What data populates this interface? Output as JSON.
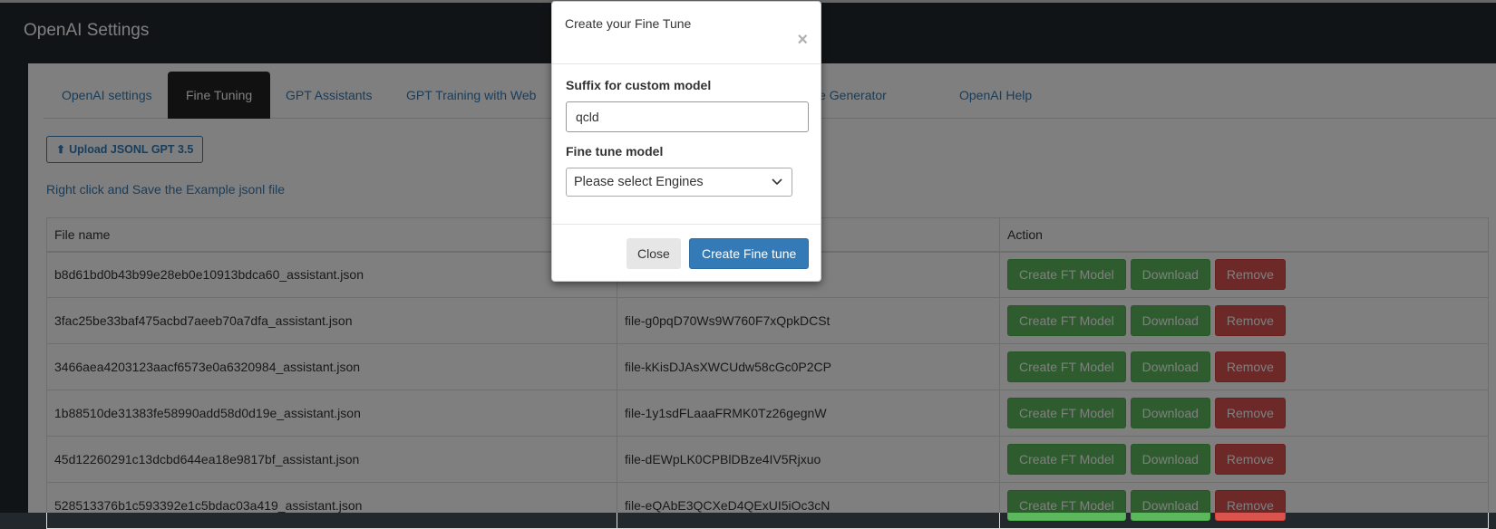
{
  "header": {
    "title": "OpenAI Settings"
  },
  "tabs": [
    {
      "label": "OpenAI settings",
      "active": false
    },
    {
      "label": "Fine Tuning",
      "active": true
    },
    {
      "label": "GPT Assistants",
      "active": false
    },
    {
      "label": "GPT Training with Web",
      "active": false
    },
    {
      "label": "Article Generator",
      "active": false
    },
    {
      "label": "OpenAI Help",
      "active": false
    }
  ],
  "upload": {
    "label": "Upload JSONL GPT 3.5",
    "icon": "upload-icon"
  },
  "example_link": "Right click and Save the Example jsonl file",
  "table": {
    "headers": [
      "File name",
      "",
      "Action"
    ],
    "rows": [
      {
        "file_name": "b8d61bd0b43b99e28eb0e10913bdca60_assistant.json",
        "file_id": ""
      },
      {
        "file_name": "3fac25be33baf475acbd7aeeb70a7dfa_assistant.json",
        "file_id": "file-g0pqD70Ws9W760F7xQpkDCSt"
      },
      {
        "file_name": "3466aea4203123aacf6573e0a6320984_assistant.json",
        "file_id": "file-kKisDJAsXWCUdw58cGc0P2CP"
      },
      {
        "file_name": "1b88510de31383fe58990add58d0d19e_assistant.json",
        "file_id": "file-1y1sdFLaaaFRMK0Tz26gegnW"
      },
      {
        "file_name": "45d12260291c13dcbd644ea18e9817bf_assistant.json",
        "file_id": "file-dEWpLK0CPBlDBze4IV5Rjxuo"
      },
      {
        "file_name": "528513376b1c593392e1c5bdac03a419_assistant.json",
        "file_id": "file-eQAbE3QCXeD4QExUI5iOc3cN"
      }
    ],
    "actions": {
      "create": "Create FT Model",
      "download": "Download",
      "remove": "Remove"
    }
  },
  "modal": {
    "title": "Create your Fine Tune",
    "close_icon": "×",
    "suffix_label": "Suffix for custom model",
    "suffix_value": "qcld",
    "model_label": "Fine tune model",
    "model_select": "Please select Engines",
    "close_button": "Close",
    "create_button": "Create Fine tune"
  },
  "colors": {
    "header_bg": "#23282d",
    "primary": "#337ab7",
    "success": "#5cb85c",
    "danger": "#d9534f"
  }
}
